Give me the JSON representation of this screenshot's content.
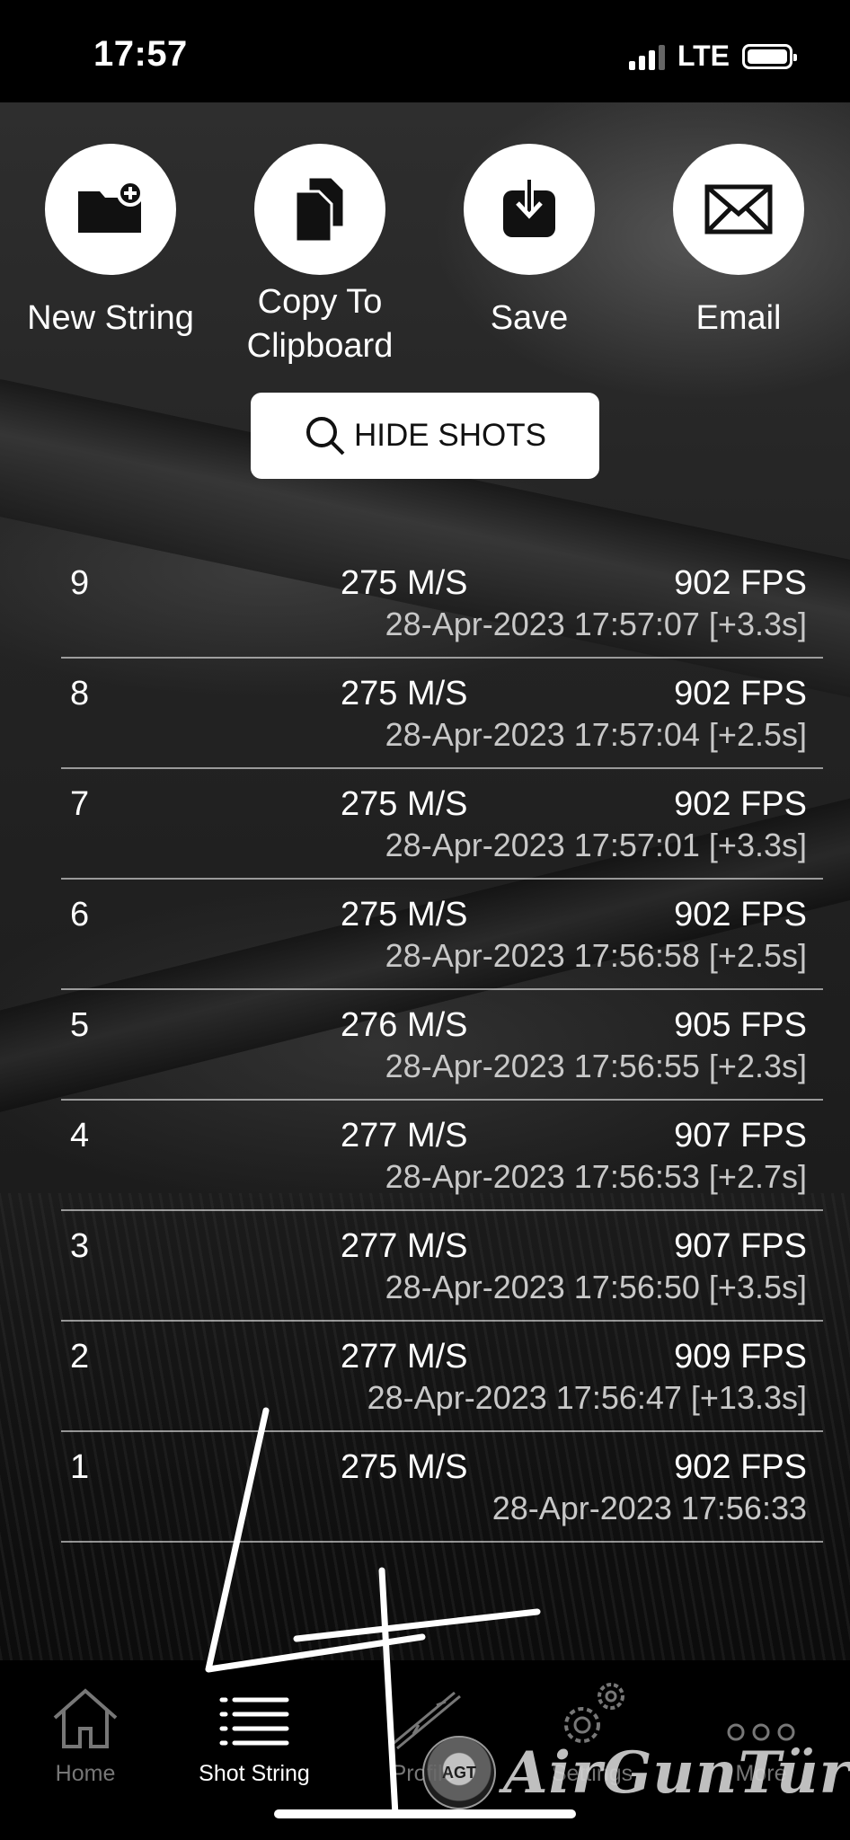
{
  "status_bar": {
    "time": "17:57",
    "network": "LTE"
  },
  "actions": [
    {
      "label": "New String",
      "icon": "folder-plus-icon"
    },
    {
      "label": "Copy To\nClipboard",
      "icon": "copy-icon"
    },
    {
      "label": "Save",
      "icon": "download-icon"
    },
    {
      "label": "Email",
      "icon": "envelope-icon"
    }
  ],
  "hide_shots": {
    "label": "HIDE SHOTS",
    "icon": "search-icon"
  },
  "shots": [
    {
      "num": "9",
      "ms": "275 M/S",
      "fps": "902 FPS",
      "timestamp": "28-Apr-2023 17:57:07 [+3.3s]"
    },
    {
      "num": "8",
      "ms": "275 M/S",
      "fps": "902 FPS",
      "timestamp": "28-Apr-2023 17:57:04 [+2.5s]"
    },
    {
      "num": "7",
      "ms": "275 M/S",
      "fps": "902 FPS",
      "timestamp": "28-Apr-2023 17:57:01 [+3.3s]"
    },
    {
      "num": "6",
      "ms": "275 M/S",
      "fps": "902 FPS",
      "timestamp": "28-Apr-2023 17:56:58 [+2.5s]"
    },
    {
      "num": "5",
      "ms": "276 M/S",
      "fps": "905 FPS",
      "timestamp": "28-Apr-2023 17:56:55 [+2.3s]"
    },
    {
      "num": "4",
      "ms": "277 M/S",
      "fps": "907 FPS",
      "timestamp": "28-Apr-2023 17:56:53 [+2.7s]"
    },
    {
      "num": "3",
      "ms": "277 M/S",
      "fps": "907 FPS",
      "timestamp": "28-Apr-2023 17:56:50 [+3.5s]"
    },
    {
      "num": "2",
      "ms": "277 M/S",
      "fps": "909 FPS",
      "timestamp": "28-Apr-2023 17:56:47 [+13.3s]"
    },
    {
      "num": "1",
      "ms": "275 M/S",
      "fps": "902 FPS",
      "timestamp": "28-Apr-2023 17:56:33"
    }
  ],
  "tabs": [
    {
      "label": "Home",
      "icon": "home-icon",
      "active": false
    },
    {
      "label": "Shot String",
      "icon": "list-icon",
      "active": true
    },
    {
      "label": "Profile",
      "icon": "rifle-icon",
      "active": false
    },
    {
      "label": "Settings",
      "icon": "gears-icon",
      "active": false
    },
    {
      "label": "More",
      "icon": "more-dots-icon",
      "active": false
    }
  ],
  "watermark": {
    "text": "AirGunTürk",
    "badge": "AGT"
  }
}
